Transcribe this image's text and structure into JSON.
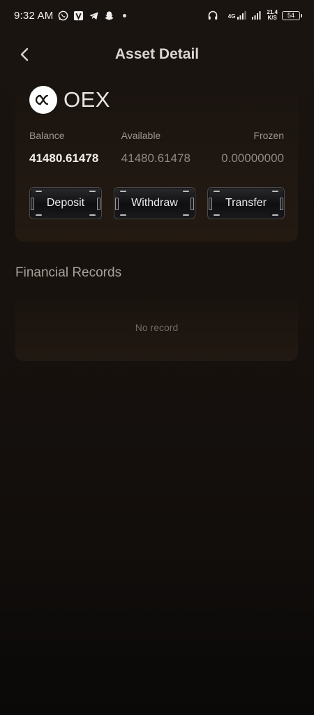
{
  "status_bar": {
    "time": "9:32 AM",
    "network_top": "4G",
    "speed": "21.4",
    "speed_unit": "K/S",
    "battery": "54"
  },
  "header": {
    "title": "Asset Detail",
    "back_icon": "chevron-left-icon"
  },
  "asset": {
    "coin_name": "OEX",
    "logo_icon": "oex-logo-icon",
    "labels": {
      "balance": "Balance",
      "available": "Available",
      "frozen": "Frozen"
    },
    "values": {
      "balance": "41480.61478",
      "available": "41480.61478",
      "frozen": "0.00000000"
    },
    "actions": {
      "deposit": "Deposit",
      "withdraw": "Withdraw",
      "transfer": "Transfer"
    }
  },
  "records": {
    "title": "Financial Records",
    "empty_text": "No record"
  }
}
